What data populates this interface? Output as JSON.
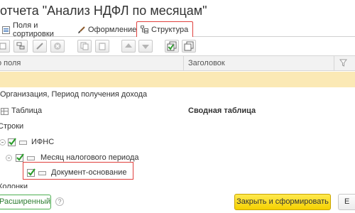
{
  "window": {
    "title": "отчета \"Анализ НДФЛ по месяцам\""
  },
  "tabs": [
    {
      "label": "Поля и сортировки",
      "icon": "fields-icon"
    },
    {
      "label": "Оформление",
      "icon": "brush-icon"
    },
    {
      "label": "Структура",
      "icon": "structure-icon",
      "active": true
    }
  ],
  "grid": {
    "columns": [
      "о поля",
      "Заголовок"
    ],
    "rows": [
      {
        "label": "",
        "highlighted": true
      },
      {
        "label": "Организация, Период получения дохода"
      },
      {
        "label": "Таблица",
        "title": "Сводная таблица"
      },
      {
        "label": "Строки"
      },
      {
        "label": "ИФНС",
        "checked": true
      },
      {
        "label": "Месяц налогового периода",
        "checked": true
      },
      {
        "label": "Документ-основание",
        "checked": true
      },
      {
        "label": "Колонки"
      }
    ]
  },
  "footer": {
    "advanced": "Расширенный",
    "help": "?",
    "submit": "Закрыть и сформировать",
    "more": "Е"
  },
  "colors": {
    "accent_red": "#e0403d",
    "highlight_row": "#fbe9b5",
    "primary_button": "#f5d100",
    "advanced_green": "#4caf50"
  }
}
